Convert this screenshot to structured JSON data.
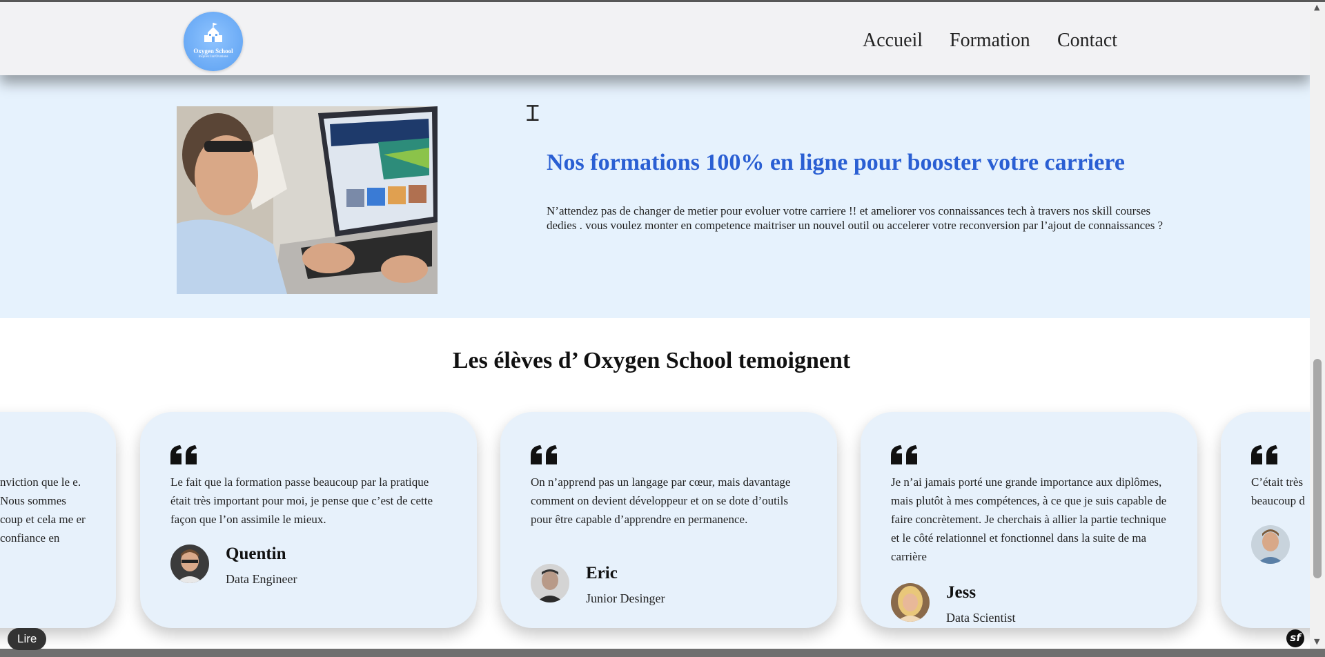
{
  "header": {
    "logo_name": "Oxygen School",
    "logo_tagline": "Inspirez Inn'Ovations",
    "nav": [
      "Accueil",
      "Formation",
      "Contact"
    ]
  },
  "hero": {
    "title": "Nos formations 100% en ligne pour booster votre carriere",
    "text": "N’attendez pas de changer de metier pour evoluer votre carriere !! et ameliorer vos connaissances tech à travers nos skill courses dedies . vous voulez monter en competence maitriser un nouvel outil ou accelerer votre reconversion par l’ajout de connaissances ?"
  },
  "testimonials": {
    "title": "Les élèves d’ Oxygen School temoignent",
    "cards": [
      {
        "text": "nviction que le e. Nous sommes coup et cela me er confiance en",
        "name": "",
        "role": ""
      },
      {
        "text": "Le fait que la formation passe beaucoup par la pratique était très important pour moi, je pense que c’est de cette façon que l’on assimile le mieux.",
        "name": "Quentin",
        "role": "Data Engineer"
      },
      {
        "text": "On n’apprend pas un langage par cœur, mais davantage comment on devient développeur et on se dote d’outils pour être capable d’apprendre en permanence.",
        "name": "Eric",
        "role": "Junior Desinger"
      },
      {
        "text": "Je n’ai jamais porté une grande importance aux diplômes, mais plutôt à mes compétences, à ce que je suis capable de faire concrètement. Je cherchais à allier la partie technique et le côté relationnel et fonctionnel dans la suite de ma carrière",
        "name": "Jess",
        "role": "Data Scientist"
      },
      {
        "text": "C’était très beaucoup d",
        "name": "",
        "role": ""
      }
    ]
  },
  "overlay": {
    "read_label": "Lire",
    "sf_label": "sf"
  },
  "colors": {
    "accent_title": "#2a5fd3",
    "hero_bg": "#e6f2fd",
    "card_bg": "#e7f1fb",
    "logo_bg": "#6aaaf5"
  },
  "icons": {
    "quote": "quote-icon",
    "cursor": "text-cursor-icon",
    "school": "school-building-icon"
  }
}
